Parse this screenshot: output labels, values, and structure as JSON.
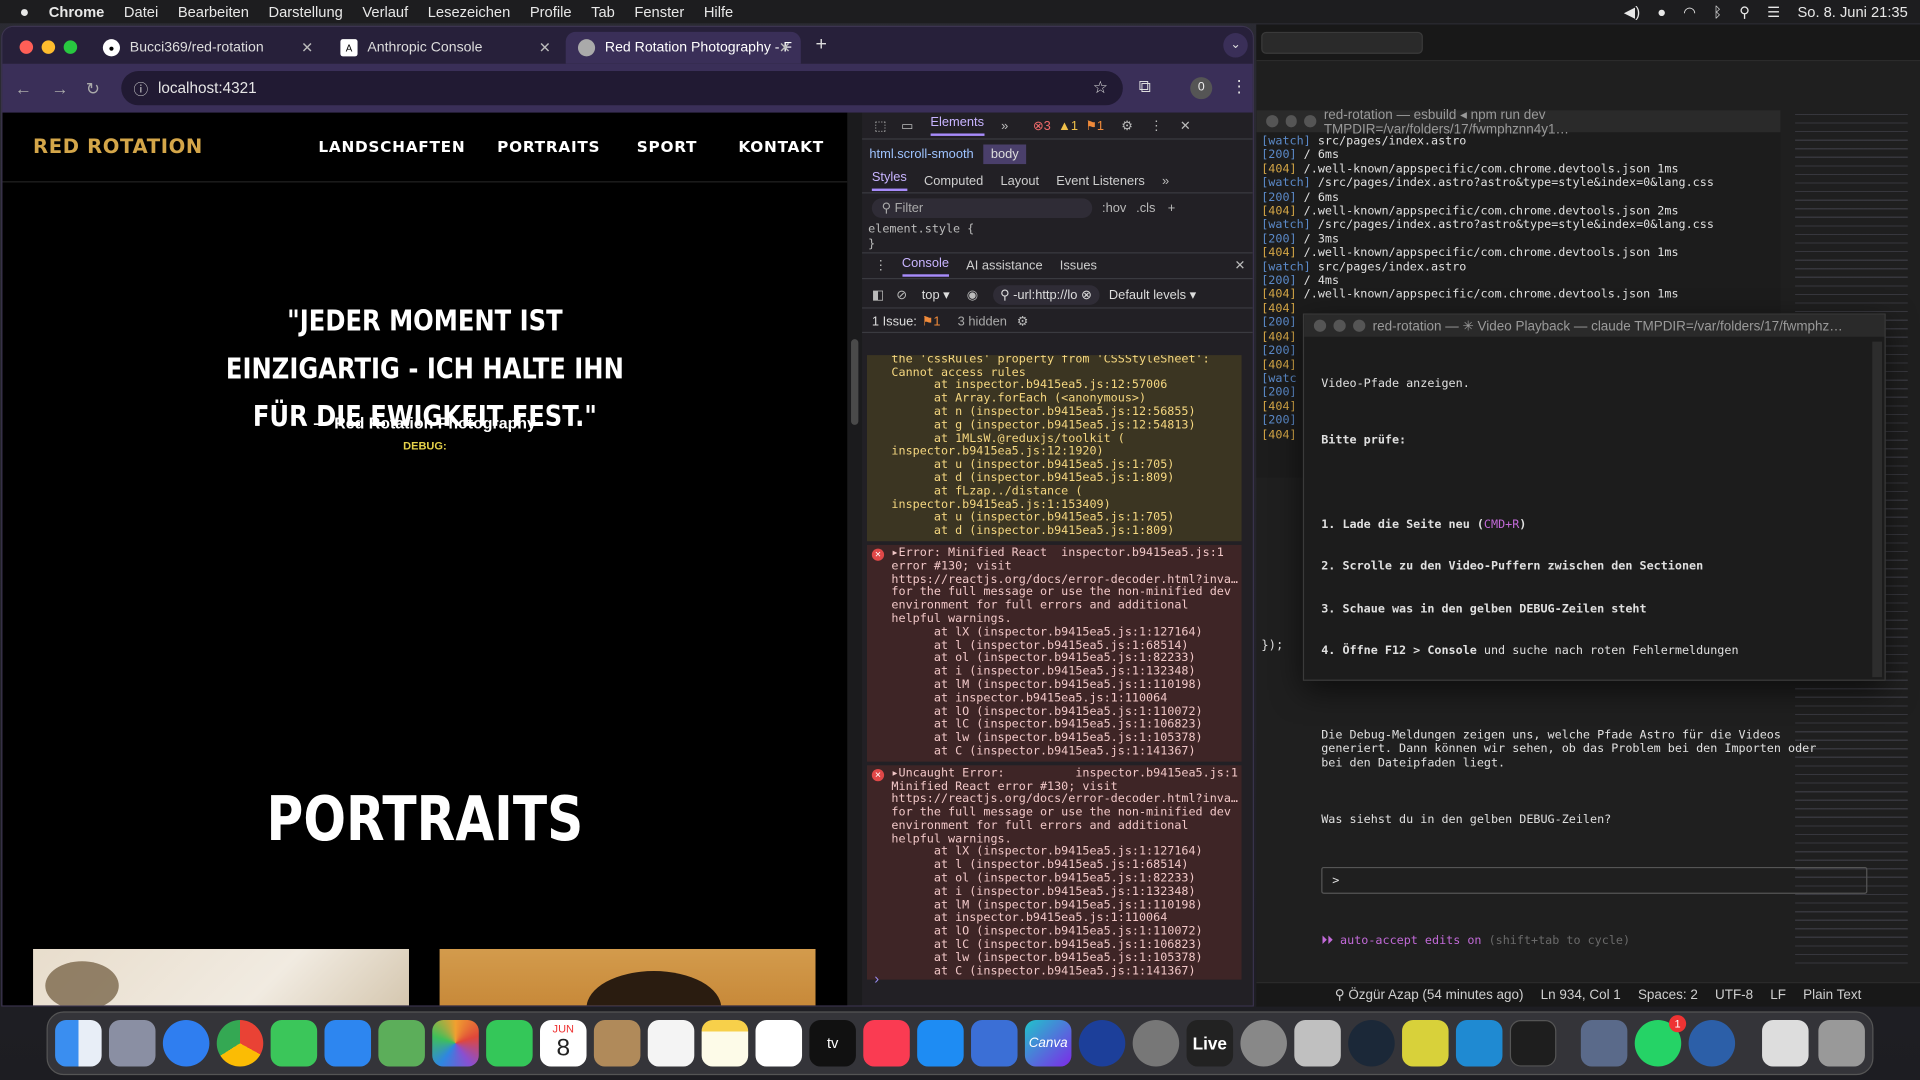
{
  "menubar": {
    "apple": "",
    "app": "Chrome",
    "items": [
      "Datei",
      "Bearbeiten",
      "Darstellung",
      "Verlauf",
      "Lesezeichen",
      "Profile",
      "Tab",
      "Fenster",
      "Hilfe"
    ],
    "clock": "So. 8. Juni  21:35"
  },
  "chrome": {
    "tabs": [
      {
        "title": "Bucci369/red-rotation",
        "icon": "github-icon"
      },
      {
        "title": "Anthropic Console",
        "icon": "anthropic-icon"
      },
      {
        "title": "Red Rotation Photography - F",
        "icon": "globe-icon"
      }
    ],
    "url": "localhost:4321",
    "profile_badge": "0"
  },
  "site": {
    "logo": "RED ROTATION",
    "nav": [
      "LANDSCHAFTEN",
      "PORTRAITS",
      "SPORT",
      "KONTAKT"
    ],
    "quote": "\"JEDER MOMENT IST EINZIGARTIG - ICH HALTE IHN FÜR DIE EWIGKEIT FEST.\"",
    "author": "— Red Rotation Photography",
    "debug": "DEBUG:",
    "section_title": "PORTRAITS"
  },
  "devtools": {
    "top_tabs": [
      "Elements"
    ],
    "counts": {
      "errors": "3",
      "warnings": "1",
      "issues": "1"
    },
    "breadcrumb": [
      "html.scroll-smooth",
      "body"
    ],
    "style_tabs": [
      "Styles",
      "Computed",
      "Layout",
      "Event Listeners"
    ],
    "filter_placeholder": "Filter",
    "hov": ":hov",
    "cls": ".cls",
    "element_style": "element.style {",
    "element_style_close": "}",
    "drawer_tabs": [
      "Console",
      "AI assistance",
      "Issues"
    ],
    "context": "top",
    "url_filter": "-url:http://lo",
    "levels": "Default levels",
    "issues_line": "1 Issue:",
    "issues_count": "1",
    "hidden": "3 hidden",
    "console_warn": "stylesheet rules: SecurityError: Failed to read\nthe 'cssRules' property from 'CSSStyleSheet':\nCannot access rules\n      at inspector.b9415ea5.js:12:57006\n      at Array.forEach (<anonymous>)\n      at n (inspector.b9415ea5.js:12:56855)\n      at g (inspector.b9415ea5.js:12:54813)\n      at 1MLsW.@reduxjs/toolkit (\ninspector.b9415ea5.js:12:1920)\n      at u (inspector.b9415ea5.js:1:705)\n      at d (inspector.b9415ea5.js:1:809)\n      at fLzap../distance (\ninspector.b9415ea5.js:1:153409)\n      at u (inspector.b9415ea5.js:1:705)\n      at d (inspector.b9415ea5.js:1:809)",
    "console_err1": "▸Error: Minified React  inspector.b9415ea5.js:1\nerror #130; visit\nhttps://reactjs.org/docs/error-decoder.html?inva…\nfor the full message or use the non-minified dev\nenvironment for full errors and additional\nhelpful warnings.\n      at lX (inspector.b9415ea5.js:1:127164)\n      at l (inspector.b9415ea5.js:1:68514)\n      at ol (inspector.b9415ea5.js:1:82233)\n      at i (inspector.b9415ea5.js:1:132348)\n      at lM (inspector.b9415ea5.js:1:110198)\n      at inspector.b9415ea5.js:1:110064\n      at lO (inspector.b9415ea5.js:1:110072)\n      at lC (inspector.b9415ea5.js:1:106823)\n      at lw (inspector.b9415ea5.js:1:105378)\n      at C (inspector.b9415ea5.js:1:141367)",
    "console_err2": "▸Uncaught Error:          inspector.b9415ea5.js:1\nMinified React error #130; visit\nhttps://reactjs.org/docs/error-decoder.html?inva…\nfor the full message or use the non-minified dev\nenvironment for full errors and additional\nhelpful warnings.\n      at lX (inspector.b9415ea5.js:1:127164)\n      at l (inspector.b9415ea5.js:1:68514)\n      at ol (inspector.b9415ea5.js:1:82233)\n      at i (inspector.b9415ea5.js:1:132348)\n      at lM (inspector.b9415ea5.js:1:110198)\n      at inspector.b9415ea5.js:1:110064\n      at lO (inspector.b9415ea5.js:1:110072)\n      at lC (inspector.b9415ea5.js:1:106823)\n      at lw (inspector.b9415ea5.js:1:105378)\n      at C (inspector.b9415ea5.js:1:141367)",
    "prompt": "›"
  },
  "term1": {
    "title": "red-rotation — esbuild ◂ npm run dev TMPDIR=/var/folders/17/fwmphznn4y1…",
    "lines": [
      [
        "[watch]",
        "src/pages/index.astro"
      ],
      [
        "[200]",
        "/ 6ms"
      ],
      [
        "[404]",
        "/.well-known/appspecific/com.chrome.devtools.json 1ms"
      ],
      [
        "[watch]",
        "/src/pages/index.astro?astro&type=style&index=0&lang.css"
      ],
      [
        "[200]",
        "/ 6ms"
      ],
      [
        "[404]",
        "/.well-known/appspecific/com.chrome.devtools.json 2ms"
      ],
      [
        "[watch]",
        "/src/pages/index.astro?astro&type=style&index=0&lang.css"
      ],
      [
        "[200]",
        "/ 3ms"
      ],
      [
        "[404]",
        "/.well-known/appspecific/com.chrome.devtools.json 1ms"
      ],
      [
        "[watch]",
        "src/pages/index.astro"
      ],
      [
        "[200]",
        "/ 4ms"
      ],
      [
        "[404]",
        "/.well-known/appspecific/com.chrome.devtools.json 1ms"
      ],
      [
        "[404]",
        ""
      ],
      [
        "[200]",
        ""
      ],
      [
        "[404]",
        ""
      ],
      [
        "[200]",
        ""
      ],
      [
        "[404]",
        ""
      ],
      [
        "[watc",
        ""
      ],
      [
        "[200]",
        ""
      ],
      [
        "[404]",
        ""
      ],
      [
        "[200]",
        ""
      ],
      [
        "[404]",
        ""
      ]
    ]
  },
  "term2": {
    "title": "red-rotation — ✳ Video Playback — claude TMPDIR=/var/folders/17/fwmphz…",
    "intro": "Video-Pfade anzeigen.",
    "heading": "Bitte prüfe:",
    "steps": [
      "1. Lade die Seite neu (",
      "CMD+R",
      ")",
      "2. Scrolle zu den Video-Puffern zwischen den Sectionen",
      "3. Schaue was in den gelben DEBUG-Zeilen steht",
      "4. Öffne F12 > Console",
      " und suche nach roten Fehlermeldungen"
    ],
    "para": "Die Debug-Meldungen zeigen uns, welche Pfade Astro für die Videos\ngeneriert. Dann können wir sehen, ob das Problem bei den Importen oder\nbei den Dateipfaden liegt.",
    "question": "Was siehst du in den gelben DEBUG-Zeilen?",
    "prompt": ">",
    "auto": "⏵⏵ auto-accept edits on",
    "auto_hint": "(shift+tab to cycle)"
  },
  "editor": {
    "code_fragment": "});",
    "status": [
      "⚲ Özgür Azap (54 minutes ago)",
      "Ln 934, Col 1",
      "Spaces: 2",
      "UTF-8",
      "LF",
      "Plain Text"
    ]
  },
  "dock": {
    "calendar_month": "JUN",
    "calendar_day": "8",
    "whatsapp_badge": "1",
    "canva": "Canva",
    "live": "Live",
    "tv": "tv"
  },
  "colors": {
    "accent_gold": "#d4a649",
    "debug_yellow": "#e6d24a",
    "devtools_purple": "#a78bfa"
  }
}
